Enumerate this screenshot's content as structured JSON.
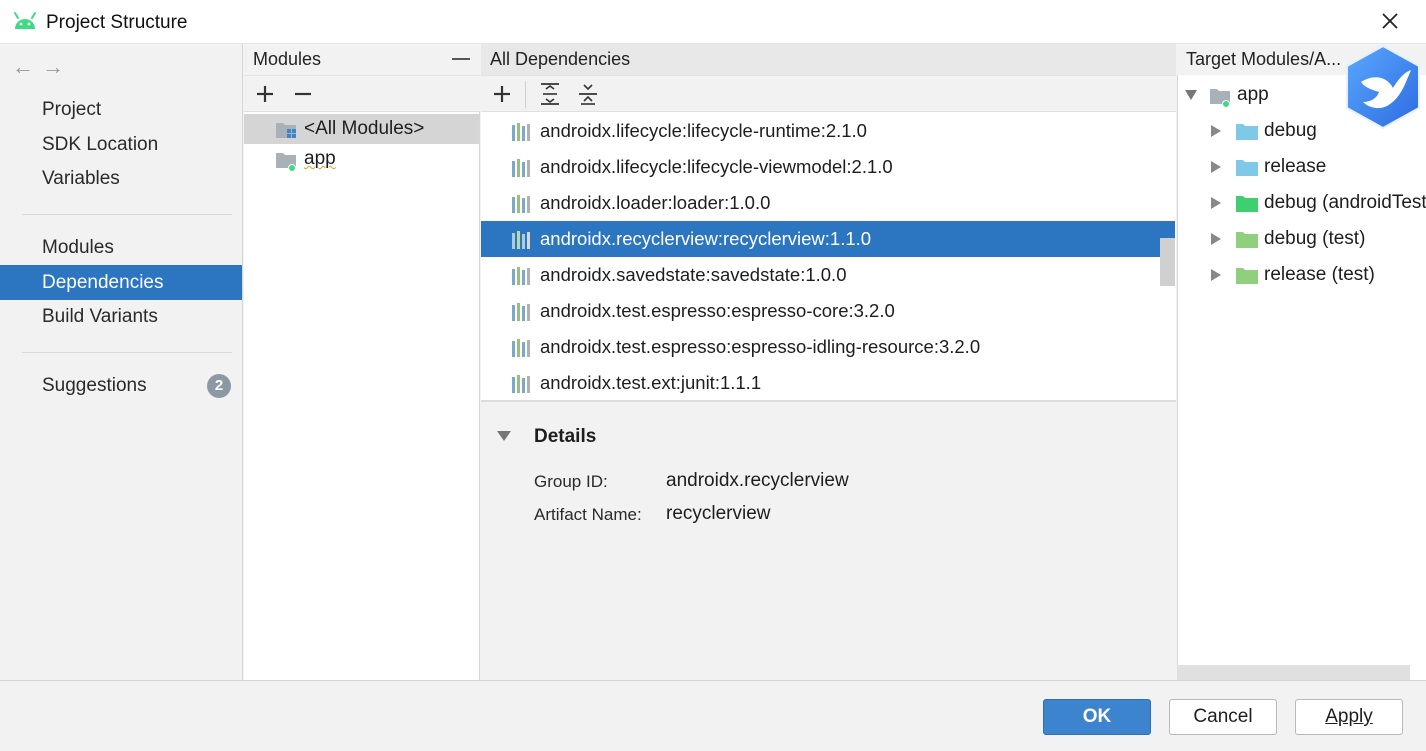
{
  "window": {
    "title": "Project Structure"
  },
  "nav": {
    "back_glyph": "←",
    "forward_glyph": "→",
    "groups": [
      {
        "items": [
          "Project",
          "SDK Location",
          "Variables"
        ]
      },
      {
        "items": [
          "Modules",
          "Dependencies",
          "Build Variants"
        ]
      },
      {
        "items": [
          "Suggestions"
        ]
      }
    ],
    "active": "Dependencies",
    "suggestions_badge": "2"
  },
  "modules": {
    "header": "Modules",
    "items": [
      {
        "label": "<All Modules>",
        "selected": true
      },
      {
        "label": "app",
        "selected": false
      }
    ]
  },
  "dependencies": {
    "header": "All Dependencies",
    "items": [
      "androidx.lifecycle:lifecycle-runtime:2.1.0",
      "androidx.lifecycle:lifecycle-viewmodel:2.1.0",
      "androidx.loader:loader:1.0.0",
      "androidx.recyclerview:recyclerview:1.1.0",
      "androidx.savedstate:savedstate:1.0.0",
      "androidx.test.espresso:espresso-core:3.2.0",
      "androidx.test.espresso:espresso-idling-resource:3.2.0",
      "androidx.test.ext:junit:1.1.1"
    ],
    "selected_index": 3
  },
  "details": {
    "title": "Details",
    "group_id_label": "Group ID:",
    "group_id_value": "androidx.recyclerview",
    "artifact_label": "Artifact Name:",
    "artifact_value": "recyclerview"
  },
  "targets": {
    "header": "Target Modules/A...",
    "root": "app",
    "children": [
      {
        "label": "debug",
        "color": "#7ec8e8"
      },
      {
        "label": "release",
        "color": "#7ec8e8"
      },
      {
        "label": "debug (androidTest)",
        "color": "#3ecf6e"
      },
      {
        "label": "debug (test)",
        "color": "#8fd07e"
      },
      {
        "label": "release (test)",
        "color": "#8fd07e"
      }
    ]
  },
  "buttons": {
    "ok": "OK",
    "cancel": "Cancel",
    "apply": "Apply"
  },
  "colors": {
    "accent": "#2b75c1",
    "ok_button": "#3d84cf"
  }
}
